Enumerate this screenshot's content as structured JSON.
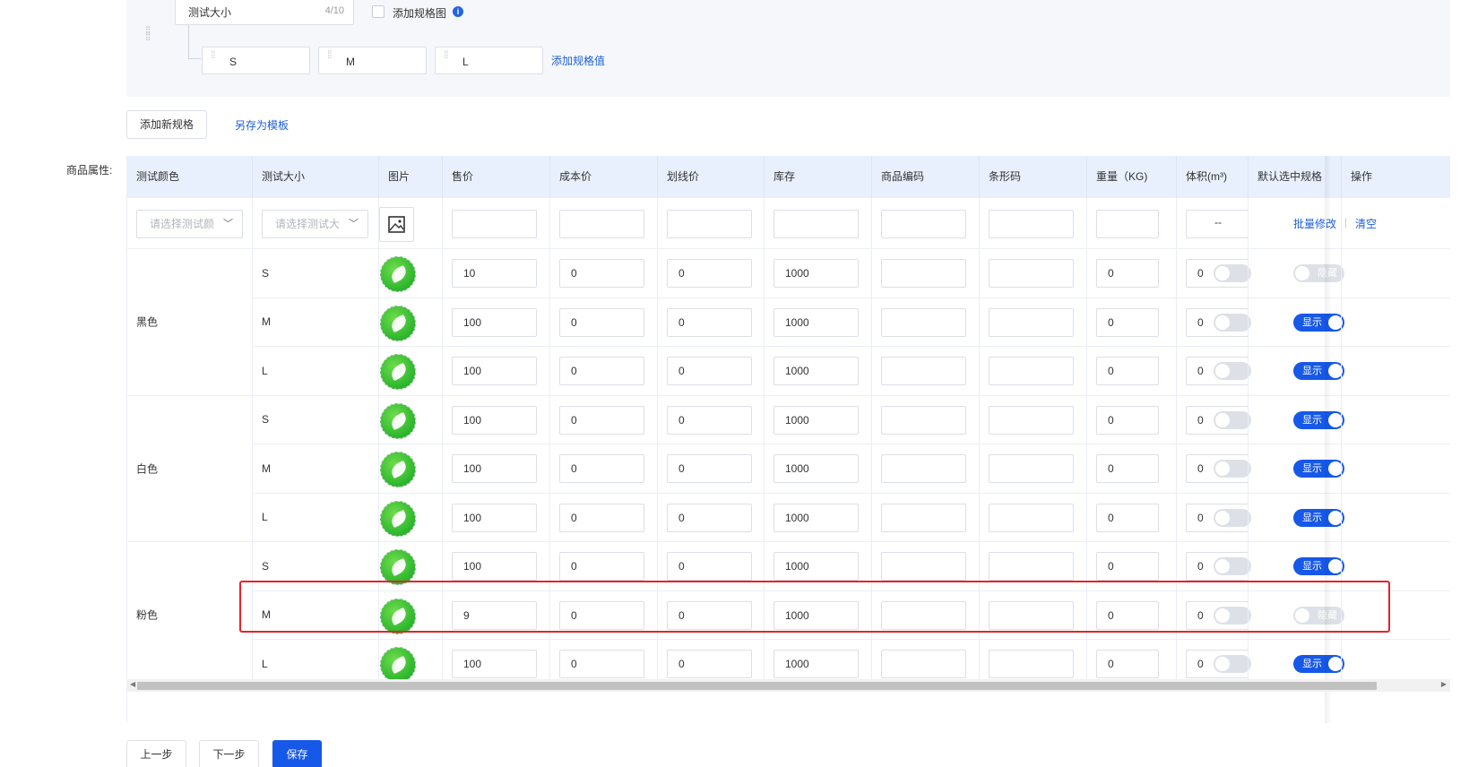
{
  "spec": {
    "name_value": "测试大小",
    "name_count": "4/10",
    "add_image_label": "添加规格图",
    "values": [
      "S",
      "M",
      "L"
    ],
    "add_value_label": "添加规格值"
  },
  "actions": {
    "add_spec": "添加新规格",
    "save_template": "另存为模板"
  },
  "attr_label": "商品属性:",
  "table": {
    "headers": [
      "测试颜色",
      "测试大小",
      "图片",
      "售价",
      "成本价",
      "划线价",
      "库存",
      "商品编码",
      "条形码",
      "重量（KG)",
      "体积(m³)",
      "默认选中规格",
      "操作"
    ],
    "batch": {
      "color_placeholder": "请选择测试颜",
      "size_placeholder": "请选择测试大",
      "default_value": "--",
      "batch_edit": "批量修改",
      "separator": "|",
      "clear": "清空"
    },
    "groups": [
      {
        "color": "黑色"
      },
      {
        "color": "白色"
      },
      {
        "color": "粉色"
      }
    ],
    "rows": [
      {
        "size": "S",
        "price": "10",
        "cost": "0",
        "list_price": "0",
        "stock": "1000",
        "sku": "",
        "barcode": "",
        "weight": "0",
        "volume": "0",
        "status": "隐藏"
      },
      {
        "size": "M",
        "price": "100",
        "cost": "0",
        "list_price": "0",
        "stock": "1000",
        "sku": "",
        "barcode": "",
        "weight": "0",
        "volume": "0",
        "status": "显示"
      },
      {
        "size": "L",
        "price": "100",
        "cost": "0",
        "list_price": "0",
        "stock": "1000",
        "sku": "",
        "barcode": "",
        "weight": "0",
        "volume": "0",
        "status": "显示"
      },
      {
        "size": "S",
        "price": "100",
        "cost": "0",
        "list_price": "0",
        "stock": "1000",
        "sku": "",
        "barcode": "",
        "weight": "0",
        "volume": "0",
        "status": "显示"
      },
      {
        "size": "M",
        "price": "100",
        "cost": "0",
        "list_price": "0",
        "stock": "1000",
        "sku": "",
        "barcode": "",
        "weight": "0",
        "volume": "0",
        "status": "显示"
      },
      {
        "size": "L",
        "price": "100",
        "cost": "0",
        "list_price": "0",
        "stock": "1000",
        "sku": "",
        "barcode": "",
        "weight": "0",
        "volume": "0",
        "status": "显示"
      },
      {
        "size": "S",
        "price": "100",
        "cost": "0",
        "list_price": "0",
        "stock": "1000",
        "sku": "",
        "barcode": "",
        "weight": "0",
        "volume": "0",
        "status": "显示"
      },
      {
        "size": "M",
        "price": "9",
        "cost": "0",
        "list_price": "0",
        "stock": "1000",
        "sku": "",
        "barcode": "",
        "weight": "0",
        "volume": "0",
        "status": "隐藏"
      },
      {
        "size": "L",
        "price": "100",
        "cost": "0",
        "list_price": "0",
        "stock": "1000",
        "sku": "",
        "barcode": "",
        "weight": "0",
        "volume": "0",
        "status": "显示"
      }
    ]
  },
  "footer": {
    "prev": "上一步",
    "next": "下一步",
    "save": "保存"
  },
  "colors": {
    "primary": "#1658e8",
    "header_bg": "#e8f0fd",
    "highlight": "#e2242b"
  }
}
